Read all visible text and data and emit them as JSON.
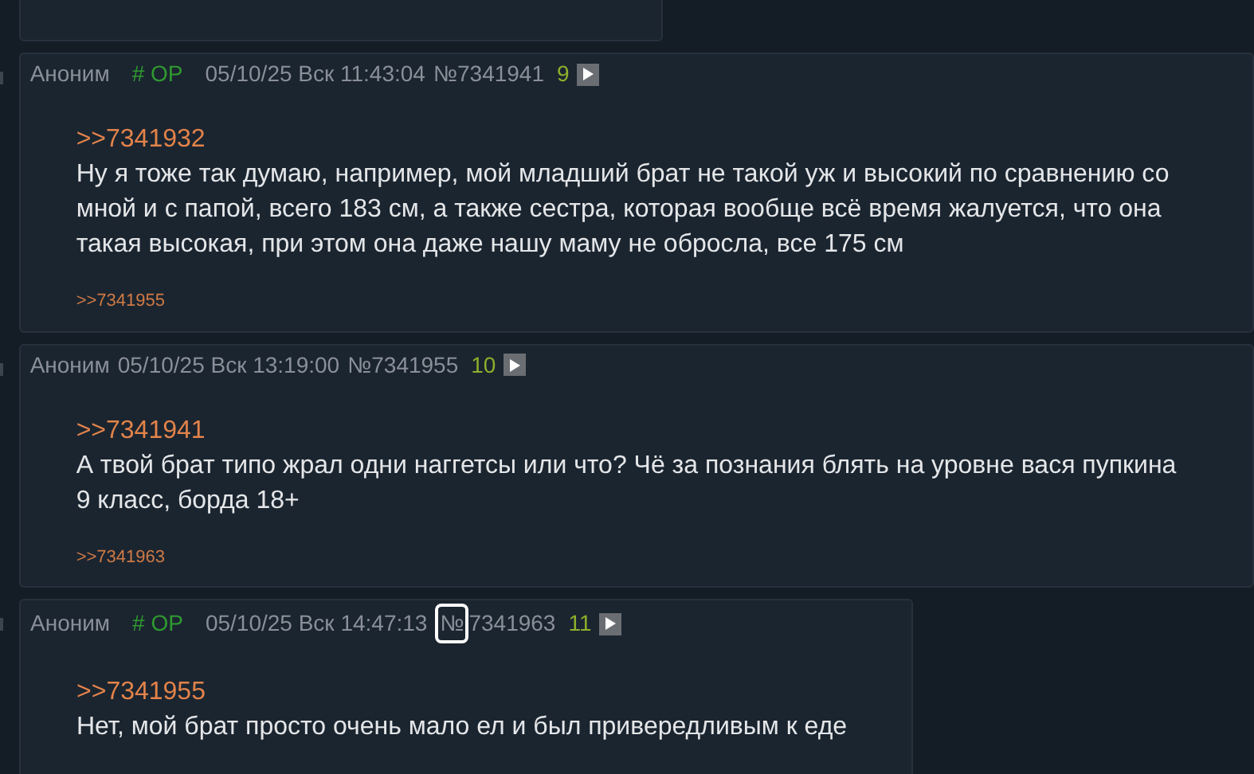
{
  "posts": [
    {
      "author": "Аноним",
      "op_tag": "# OP",
      "date": "05/10/25 Вск 11:43:04",
      "number_sign": "№",
      "number": "7341941",
      "sign_outlined": false,
      "index": "9",
      "quote": ">>7341932",
      "body": "Ну я тоже так думаю, например, мой младший брат не такой уж и высокий по сравнению со мной и с папой, всего 183 см, а также сестра, которая вообще всё время жалуется, что она такая высокая, при этом она даже нашу маму не обросла, все 175 см",
      "replies": [
        ">>7341955"
      ]
    },
    {
      "author": "Аноним",
      "date": "05/10/25 Вск 13:19:00",
      "number_sign": "№",
      "number": "7341955",
      "sign_outlined": false,
      "index": "10",
      "quote": ">>7341941",
      "body": "А твой брат типо жрал одни наггетсы или что? Чё за познания блять на уровне вася пупкина 9 класс, борда 18+",
      "replies": [
        ">>7341963"
      ]
    },
    {
      "author": "Аноним",
      "op_tag": "# OP",
      "date": "05/10/25 Вск 14:47:13",
      "number_sign": "№",
      "number": "7341963",
      "sign_outlined": true,
      "index": "11",
      "quote": ">>7341955",
      "body": "Нет, мой брат просто очень мало ел и был привередливым к еде"
    }
  ]
}
